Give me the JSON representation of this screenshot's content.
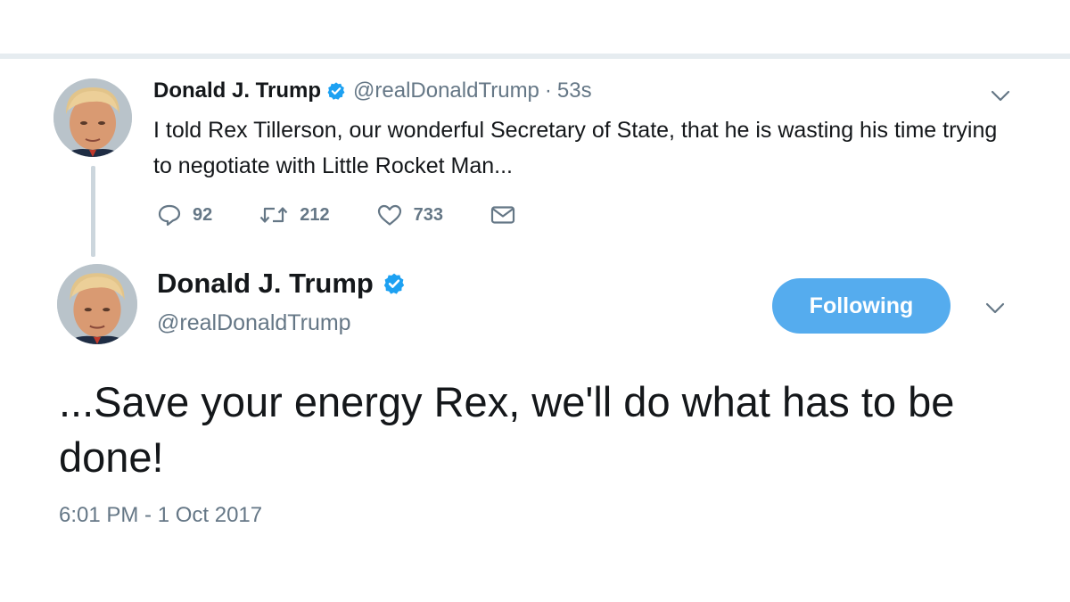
{
  "parent_tweet": {
    "name": "Donald J. Trump",
    "handle": "@realDonaldTrump",
    "separator": "·",
    "age": "53s",
    "text": "I told Rex Tillerson, our wonderful Secretary of State, that he is wasting his time trying to negotiate with Little Rocket Man...",
    "actions": {
      "replies": "92",
      "retweets": "212",
      "likes": "733"
    }
  },
  "main_tweet": {
    "name": "Donald J. Trump",
    "handle": "@realDonaldTrump",
    "follow_label": "Following",
    "text": "...Save your energy Rex, we'll do what has to be done!",
    "timestamp": "6:01 PM - 1 Oct 2017"
  },
  "colors": {
    "accent": "#55acee",
    "verified": "#1da1f2",
    "muted": "#657786",
    "thread_line": "#ccd6dd"
  },
  "icons": [
    "verified-badge-icon",
    "chevron-down-icon",
    "reply-icon",
    "retweet-icon",
    "like-icon",
    "direct-message-icon"
  ]
}
